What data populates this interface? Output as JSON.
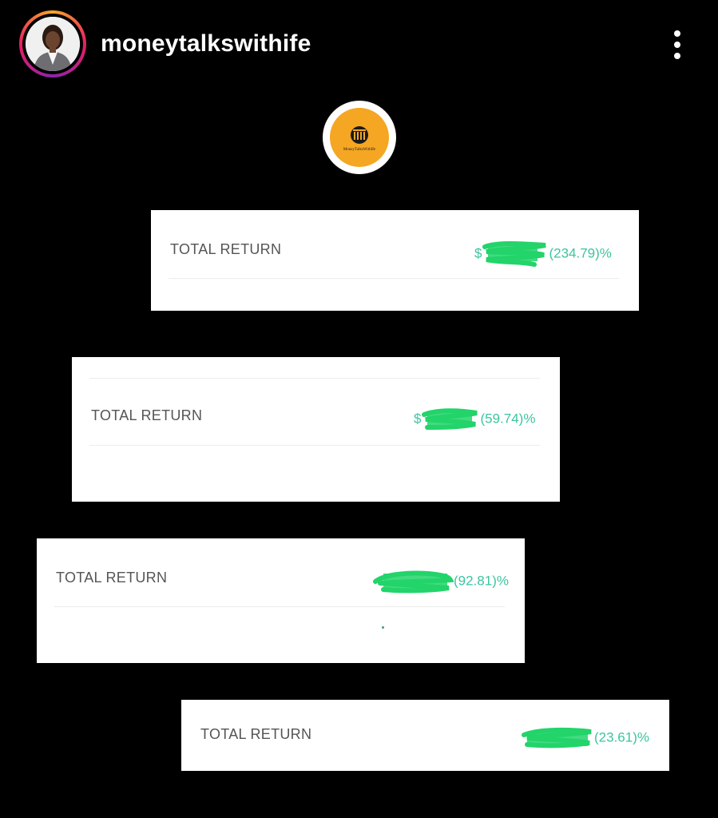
{
  "post": {
    "username": "moneytalkswithife",
    "avatar_icon": "profile-photo-avatar",
    "more_icon": "more-vertical-icon",
    "logo_text": "MoneyTalksWithIfe",
    "colors": {
      "background": "#000000",
      "card": "#ffffff",
      "accent_green": "#3cc4a0",
      "redaction_green": "#22d46a",
      "logo_orange": "#f5a623"
    }
  },
  "cards": [
    {
      "label": "TOTAL RETURN",
      "currency": "$",
      "value_suffix": "(234.79)%"
    },
    {
      "label": "TOTAL RETURN",
      "currency": "$",
      "value_suffix": "(59.74)%"
    },
    {
      "label": "TOTAL RETURN",
      "currency": "",
      "value_suffix": "(92.81)%"
    },
    {
      "label": "TOTAL RETURN",
      "currency": "",
      "value_suffix": "(23.61)%"
    }
  ]
}
